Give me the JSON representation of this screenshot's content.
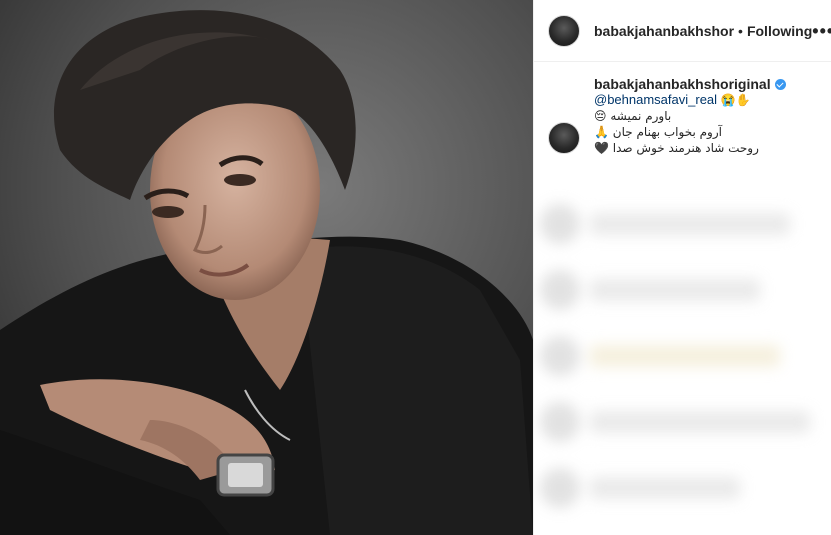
{
  "post": {
    "author": "babakjahanbakhshor",
    "separator": "•",
    "follow_status": "Following",
    "more_icon": "more-options-icon",
    "more_glyph": "•••"
  },
  "caption": {
    "username": "babakjahanbakhshoriginal",
    "verified": true,
    "mention": "@behnamsafavi_real",
    "mention_emoji": "😭✋",
    "line1_text": "باورم نمیشه",
    "line1_emoji": "😔",
    "line2_text": "آروم بخواب بهنام جان",
    "line2_emoji": "🙏",
    "line3_text": "روحت شاد هنرمند خوش صدا",
    "line3_emoji": "🖤"
  },
  "colors": {
    "accent_verified": "#3897f0",
    "mention_link": "#003569",
    "border": "#efefef"
  }
}
